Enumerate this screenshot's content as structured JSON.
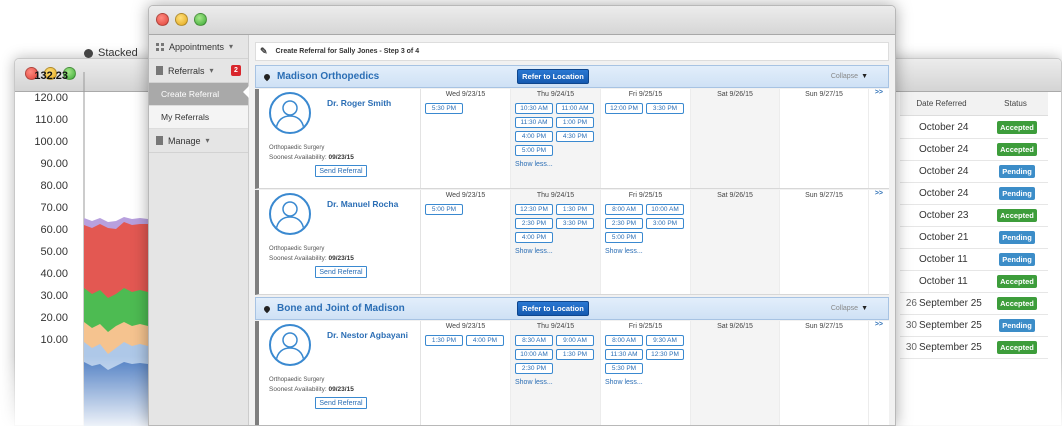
{
  "back_window": {
    "legend_label": "Stacked",
    "y_ticks": [
      "132.23",
      "120.00",
      "110.00",
      "100.00",
      "90.00",
      "80.00",
      "70.00",
      "60.00",
      "50.00",
      "40.00",
      "30.00",
      "20.00",
      "10.00"
    ],
    "table": {
      "headers": {
        "date": "Date Referred",
        "status": "Status"
      },
      "rows": [
        {
          "cut": "",
          "date": "October 24",
          "status": "Accepted"
        },
        {
          "cut": "",
          "date": "October 24",
          "status": "Accepted"
        },
        {
          "cut": "",
          "date": "October 24",
          "status": "Pending"
        },
        {
          "cut": "",
          "date": "October 24",
          "status": "Pending"
        },
        {
          "cut": "",
          "date": "October 23",
          "status": "Accepted"
        },
        {
          "cut": "",
          "date": "October 21",
          "status": "Pending"
        },
        {
          "cut": "",
          "date": "October 11",
          "status": "Pending"
        },
        {
          "cut": "",
          "date": "October 11",
          "status": "Accepted"
        },
        {
          "cut": "26",
          "date": "September 25",
          "status": "Accepted"
        },
        {
          "cut": "30",
          "date": "September 25",
          "status": "Pending"
        },
        {
          "cut": "30",
          "date": "September 25",
          "status": "Accepted"
        }
      ]
    },
    "colors": {
      "accepted": "#3d9d3b",
      "pending": "#3c8dc8"
    }
  },
  "sidebar": {
    "appointments": "Appointments",
    "referrals": "Referrals",
    "referrals_count": "2",
    "create_referral": "Create Referral",
    "my_referrals": "My Referrals",
    "manage": "Manage"
  },
  "step_title": "Create Referral for Sally Jones - Step 3 of 4",
  "common": {
    "refer_label": "Refer to Location",
    "collapse_label": "Collapse",
    "send_label": "Send Referral",
    "soonest_label": "Soonest Availability:",
    "show_less": "Show less...",
    "more": ">>"
  },
  "days": [
    "Wed 9/23/15",
    "Thu 9/24/15",
    "Fri 9/25/15",
    "Sat 9/26/15",
    "Sun 9/27/15"
  ],
  "locations": [
    {
      "name": "Madison Orthopedics",
      "doctors": [
        {
          "name": "Dr. Roger Smith",
          "specialty": "Orthopaedic Surgery",
          "soonest": "09/23/15",
          "slots": [
            [
              "5:30 PM"
            ],
            [
              "10:30 AM",
              "11:00 AM",
              "11:30 AM",
              "1:00 PM",
              "4:00 PM",
              "4:30 PM",
              "5:00 PM"
            ],
            [
              "12:00 PM",
              "3:30 PM"
            ],
            [],
            []
          ]
        },
        {
          "name": "Dr. Manuel Rocha",
          "specialty": "Orthopaedic Surgery",
          "soonest": "09/23/15",
          "slots": [
            [
              "5:00 PM"
            ],
            [
              "12:30 PM",
              "1:30 PM",
              "2:30 PM",
              "3:30 PM",
              "4:00 PM"
            ],
            [
              "8:00 AM",
              "10:00 AM",
              "2:30 PM",
              "3:00 PM",
              "5:00 PM"
            ],
            [],
            []
          ]
        }
      ]
    },
    {
      "name": "Bone and Joint of Madison",
      "doctors": [
        {
          "name": "Dr. Nestor Agbayani",
          "specialty": "Orthopaedic Surgery",
          "soonest": "09/23/15",
          "slots": [
            [
              "1:30 PM",
              "4:00 PM"
            ],
            [
              "8:30 AM",
              "9:00 AM",
              "10:00 AM",
              "1:30 PM",
              "2:30 PM"
            ],
            [
              "8:00 AM",
              "9:30 AM",
              "11:30 AM",
              "12:30 PM",
              "5:30 PM"
            ],
            [],
            []
          ]
        }
      ]
    }
  ]
}
